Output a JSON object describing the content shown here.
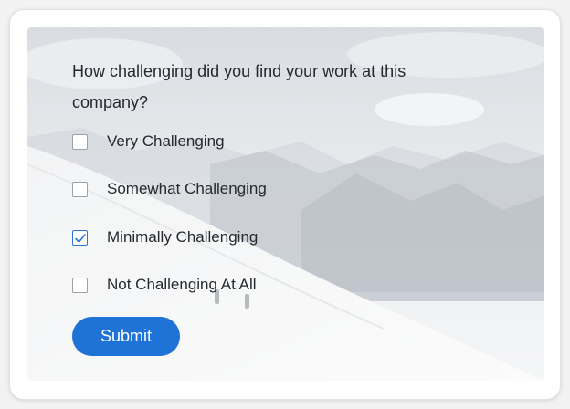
{
  "survey": {
    "question": "How challenging did you find your work at this company?",
    "options": [
      {
        "label": "Very Challenging",
        "checked": false
      },
      {
        "label": "Somewhat Challenging",
        "checked": false
      },
      {
        "label": "Minimally Challenging",
        "checked": true
      },
      {
        "label": "Not Challenging At All",
        "checked": false
      }
    ],
    "submit_label": "Submit"
  },
  "colors": {
    "accent": "#1f73d6",
    "checkbox_checked": "#2b74d6",
    "text": "#262a30"
  },
  "icons": {
    "checkmark": "checkmark-icon",
    "background": "snowy-mountain-background"
  }
}
